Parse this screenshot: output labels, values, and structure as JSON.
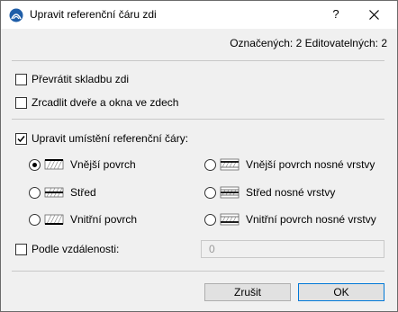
{
  "dialog": {
    "title": "Upravit referenční čáru zdi",
    "help_label": "?",
    "selected_info": "Označených: 2 Editovatelných: 2"
  },
  "options": {
    "flip_structure": {
      "label": "Převrátit skladbu zdi",
      "checked": false
    },
    "mirror_openings": {
      "label": "Zrcadlit dveře a okna ve zdech",
      "checked": false
    },
    "adjust_reference_line": {
      "label": "Upravit umístění referenční čáry:",
      "checked": true
    }
  },
  "reference_positions": [
    {
      "label": "Vnější povrch",
      "selected": true,
      "icon": "wall-exterior-face-icon"
    },
    {
      "label": "Střed",
      "selected": false,
      "icon": "wall-center-icon"
    },
    {
      "label": "Vnitřní povrch",
      "selected": false,
      "icon": "wall-interior-face-icon"
    },
    {
      "label": "Vnější povrch nosné vrstvy",
      "selected": false,
      "icon": "core-exterior-face-icon"
    },
    {
      "label": "Střed nosné vrstvy",
      "selected": false,
      "icon": "core-center-icon"
    },
    {
      "label": "Vnitřní povrch nosné vrstvy",
      "selected": false,
      "icon": "core-interior-face-icon"
    }
  ],
  "distance": {
    "label": "Podle vzdálenosti:",
    "checked": false,
    "value": "0"
  },
  "buttons": {
    "cancel_label": "Zrušit",
    "ok_label": "OK"
  }
}
